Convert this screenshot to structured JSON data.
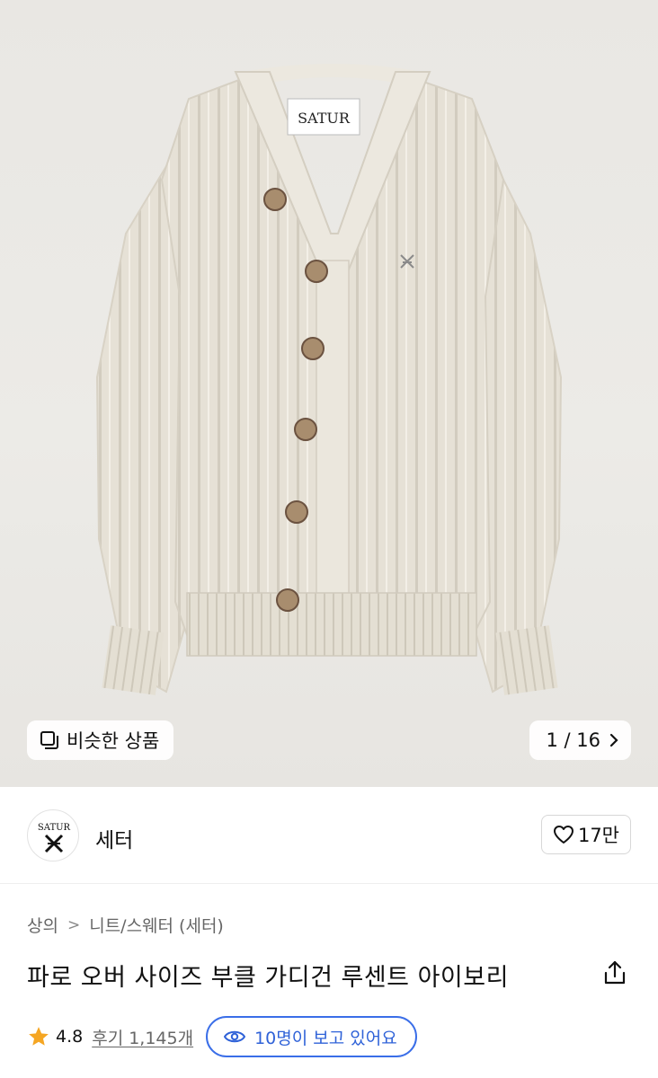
{
  "gallery": {
    "similar_label": "비슷한 상품",
    "counter": "1 / 16",
    "label_tag": "SATUR"
  },
  "brand": {
    "logo_text": "SATUR",
    "name": "세터",
    "like_count": "17만"
  },
  "product": {
    "breadcrumb": [
      "상의",
      "니트/스웨터 (세터)"
    ],
    "title": "파로 오버 사이즈 부클 가디건 루센트 아이보리",
    "rating": "4.8",
    "reviews": "후기 1,145개",
    "viewers": "10명이 보고 있어요"
  },
  "colors": {
    "accent_blue": "#3a6ee8",
    "star": "#f5a623"
  }
}
